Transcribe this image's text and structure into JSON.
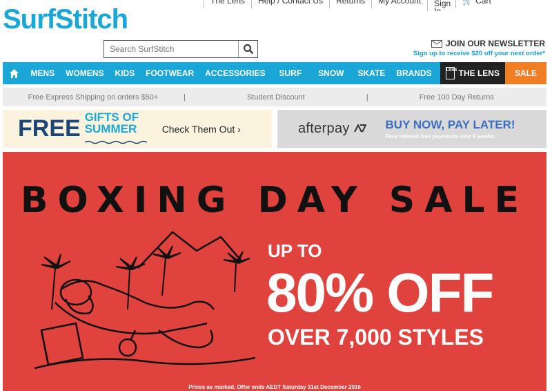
{
  "brand": {
    "logo_text": "SurfStitch"
  },
  "utility_links": [
    "The Lens",
    "Help / Contact Us",
    "Returns",
    "My Account",
    "Sign In",
    "Cart"
  ],
  "search": {
    "placeholder": "Search SurfStitch"
  },
  "newsletter": {
    "title": "JOIN OUR NEWSLETTER",
    "subtitle": "Sign up to receive $20 off your next order*"
  },
  "nav": {
    "items": [
      "MENS",
      "WOMENS",
      "KIDS",
      "FOOTWEAR",
      "ACCESSORIES",
      "SURF",
      "SNOW",
      "SKATE",
      "BRANDS"
    ],
    "lens_label": "THE LENS",
    "lens_box": "LENS",
    "sale_label": "SALE"
  },
  "shipping_bar": [
    "Free Express Shipping on orders $50+",
    "Student Discount",
    "Free 100 Day Returns"
  ],
  "promo_gifts": {
    "free": "FREE",
    "line1": "GIFTS OF",
    "line2": "SUMMER",
    "cta": "Check Them Out ›"
  },
  "promo_afterpay": {
    "logo": "afterpay",
    "headline": "BUY NOW, PAY LATER!",
    "sub": "Four interest free payments over 8 weeks."
  },
  "hero": {
    "title": "BOXING DAY SALE",
    "up_to": "UP TO",
    "discount": "80% OFF",
    "styles": "OVER 7,000 STYLES",
    "fine_print": "Prices as marked. Offer ends AEDT Saturday 31st December 2016"
  },
  "colors": {
    "brand_blue": "#1aa6d6",
    "sale_orange": "#f07e25",
    "hero_red": "#e0423d",
    "navy": "#1c4576"
  }
}
